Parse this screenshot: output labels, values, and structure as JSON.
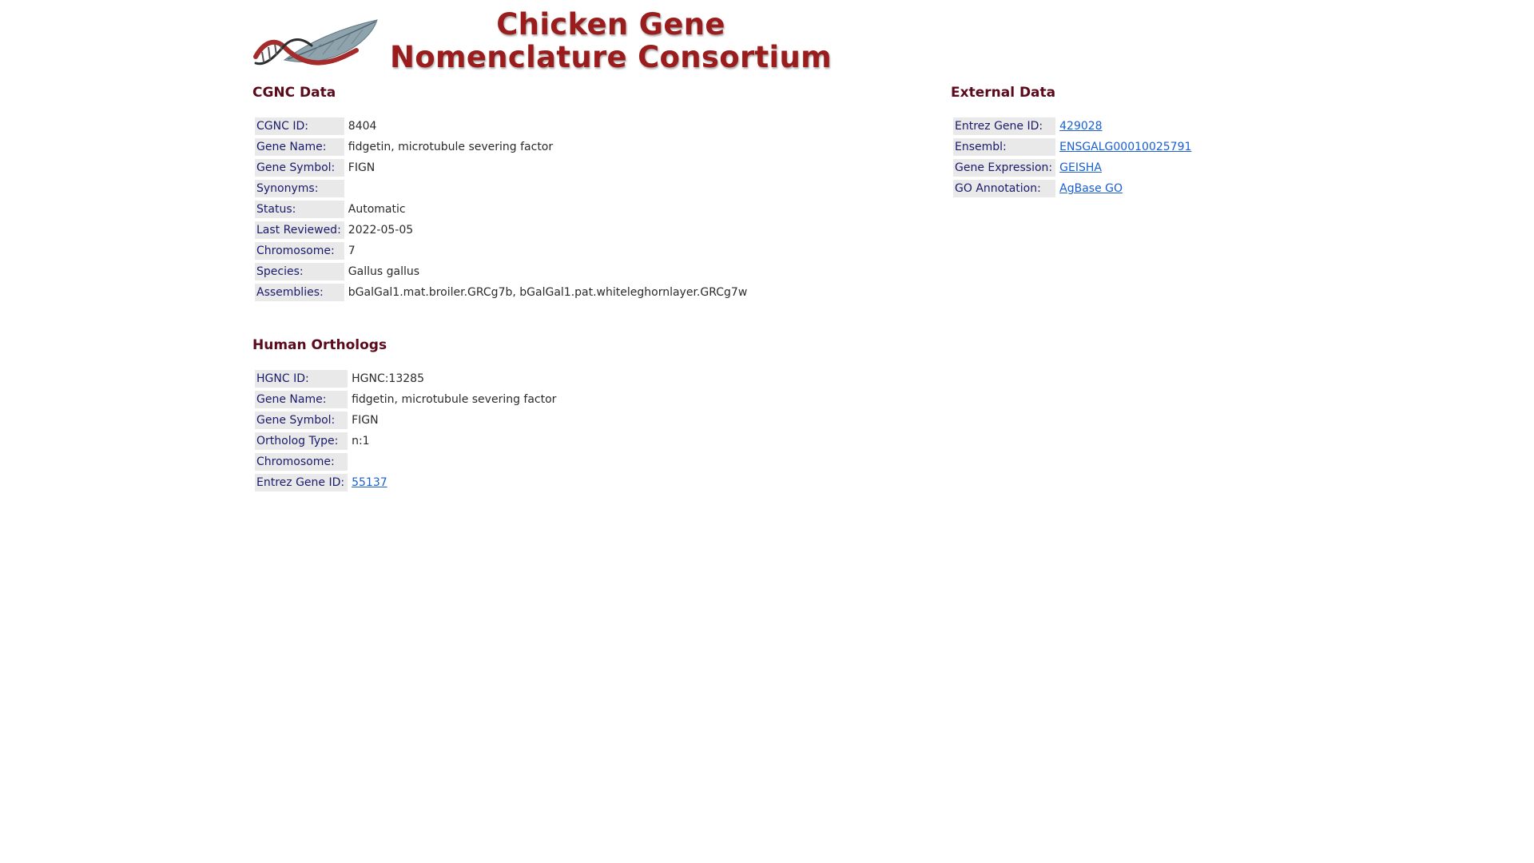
{
  "header": {
    "title_line1": "Chicken Gene",
    "title_line2": "Nomenclature Consortium",
    "logo_icon": "dna-feather-logo-icon",
    "title_color": "#9b1c1c"
  },
  "cgnc": {
    "heading": "CGNC Data",
    "rows": [
      {
        "label": "CGNC ID:",
        "value": "8404"
      },
      {
        "label": "Gene Name:",
        "value": "fidgetin, microtubule severing factor"
      },
      {
        "label": "Gene Symbol:",
        "value": "FIGN"
      },
      {
        "label": "Synonyms:",
        "value": ""
      },
      {
        "label": "Status:",
        "value": "Automatic"
      },
      {
        "label": "Last Reviewed:",
        "value": "2022-05-05"
      },
      {
        "label": "Chromosome:",
        "value": "7"
      },
      {
        "label": "Species:",
        "value": "Gallus gallus"
      },
      {
        "label": "Assemblies:",
        "value": "bGalGal1.mat.broiler.GRCg7b, bGalGal1.pat.whiteleghornlayer.GRCg7w"
      }
    ]
  },
  "external": {
    "heading": "External Data",
    "rows": [
      {
        "label": "Entrez Gene ID:",
        "value": "429028"
      },
      {
        "label": "Ensembl:",
        "value": "ENSGALG00010025791"
      },
      {
        "label": "Gene Expression:",
        "value": "GEISHA"
      },
      {
        "label": "GO Annotation:",
        "value": "AgBase GO"
      }
    ]
  },
  "orthologs": {
    "heading": "Human Orthologs",
    "rows": [
      {
        "label": "HGNC ID:",
        "value": "HGNC:13285"
      },
      {
        "label": "Gene Name:",
        "value": "fidgetin, microtubule severing factor"
      },
      {
        "label": "Gene Symbol:",
        "value": "FIGN"
      },
      {
        "label": "Ortholog Type:",
        "value": "n:1"
      },
      {
        "label": "Chromosome:",
        "value": ""
      },
      {
        "label": "Entrez Gene ID:",
        "value": "55137"
      }
    ]
  },
  "colors": {
    "heading": "#5b0a1c",
    "label_bg": "#e9e9e9",
    "label_text": "#1a1a6b",
    "link": "#1a5fd1"
  }
}
